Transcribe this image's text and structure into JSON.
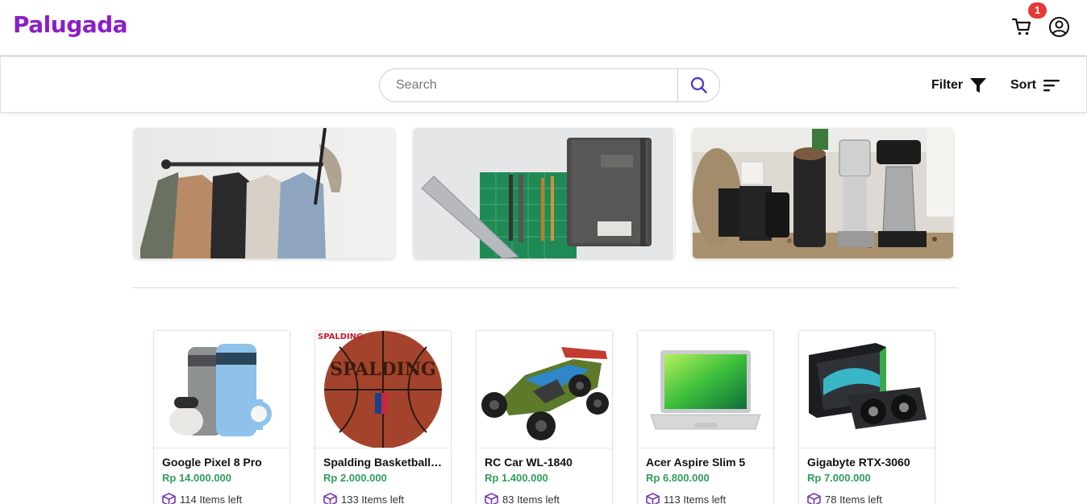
{
  "header": {
    "logo": "Palugada",
    "cart_count": "1",
    "brand_color": "#8a1fc7"
  },
  "toolbar": {
    "search_placeholder": "Search",
    "filter_label": "Filter",
    "sort_label": "Sort"
  },
  "categories": [
    {
      "name": "clothing-rack-banner"
    },
    {
      "name": "stationery-banner"
    },
    {
      "name": "coffee-equipment-banner"
    }
  ],
  "products": [
    {
      "name": "Google Pixel 8 Pro",
      "price": "Rp 14.000.000",
      "stock": "114 Items left"
    },
    {
      "name": "Spalding Basketball NBA",
      "price": "Rp 2.000.000",
      "stock": "133 Items left"
    },
    {
      "name": "RC Car WL-1840",
      "price": "Rp 1.400.000",
      "stock": "83 Items left"
    },
    {
      "name": "Acer Aspire Slim 5",
      "price": "Rp 6.800.000",
      "stock": "113 Items left"
    },
    {
      "name": "Gigabyte RTX-3060",
      "price": "Rp 7.000.000",
      "stock": "78 Items left"
    }
  ],
  "colors": {
    "price": "#2e9e5a",
    "badge": "#e53935",
    "icon_purple": "#7b3fb5"
  }
}
